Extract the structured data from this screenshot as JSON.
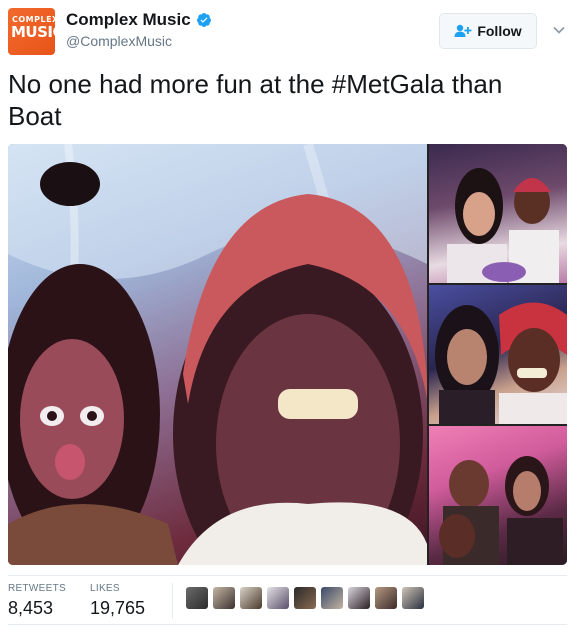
{
  "account": {
    "avatar_line1": "COMPLEX",
    "avatar_line2": "MUSIC",
    "display_name": "Complex Music",
    "handle": "@ComplexMusic",
    "verified_icon": "verified-badge-icon",
    "brand_color": "#f26a2d"
  },
  "actions": {
    "follow_label": "Follow",
    "follow_icon": "add-user-icon",
    "menu_icon": "chevron-down-icon"
  },
  "tweet": {
    "text": "No one had more fun at the #MetGala than Boat"
  },
  "media": {
    "photo_count": 4
  },
  "stats": {
    "retweets_label": "RETWEETS",
    "retweets_value": "8,453",
    "likes_label": "LIKES",
    "likes_value": "19,765"
  },
  "likers": {
    "count": 9
  },
  "colors": {
    "verified_blue": "#1da1f2",
    "secondary_text": "#657786",
    "border": "#e1e8ed"
  }
}
